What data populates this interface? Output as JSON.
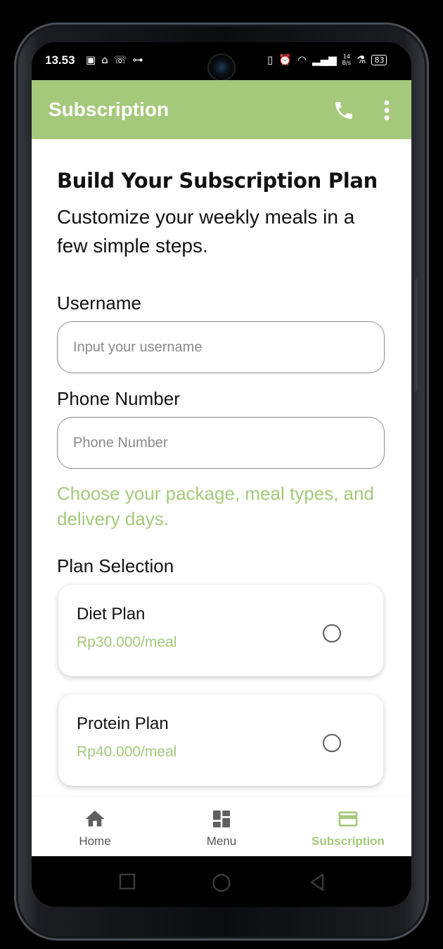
{
  "status_bar": {
    "time": "13.53",
    "left_icons": [
      "pinterest-icon",
      "notification-icon",
      "missed-call-icon",
      "gamepad-icon"
    ],
    "right_icons": [
      "vibrate-icon",
      "alarm-icon",
      "wifi-icon",
      "signal-icon"
    ],
    "net_speed_value": "14",
    "net_speed_unit": "B/s",
    "battery": "83"
  },
  "appbar": {
    "title": "Subscription",
    "color": "#a5c97b"
  },
  "form": {
    "heading": "Build Your Subscription Plan",
    "subheading": "Customize your weekly meals in a few simple steps.",
    "username_label": "Username",
    "username_placeholder": "Input your username",
    "phone_label": "Phone Number",
    "phone_placeholder": "Phone Number",
    "choose_text": "Choose your package, meal types, and delivery days.",
    "plan_section_label": "Plan Selection"
  },
  "plans": [
    {
      "name": "Diet Plan",
      "price": "Rp30.000/meal",
      "selected": false
    },
    {
      "name": "Protein Plan",
      "price": "Rp40.000/meal",
      "selected": false
    }
  ],
  "bottom_nav": [
    {
      "label": "Home",
      "icon": "home-icon",
      "active": false
    },
    {
      "label": "Menu",
      "icon": "dashboard-icon",
      "active": false
    },
    {
      "label": "Subscription",
      "icon": "card-icon",
      "active": true
    }
  ]
}
